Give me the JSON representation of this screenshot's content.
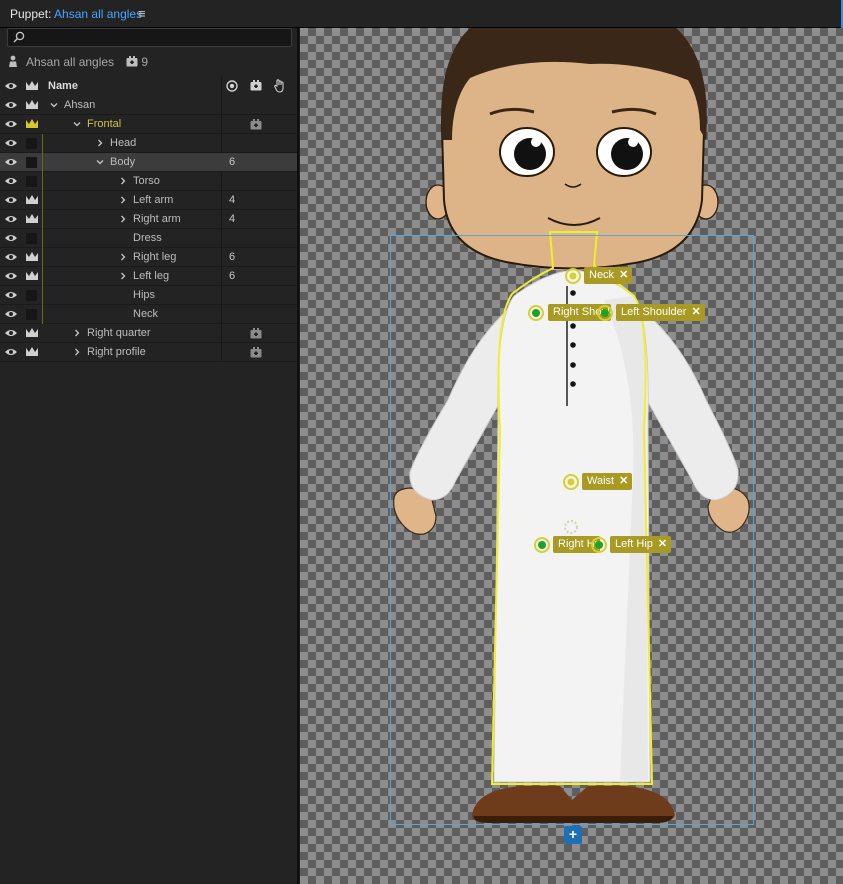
{
  "window": {
    "panel_prefix": "Puppet:",
    "document_name": "Ahsan all angles",
    "menu_icon": "hamburger-menu-icon"
  },
  "search": {
    "placeholder": "",
    "icon": "search-icon"
  },
  "puppet_header": {
    "name": "Ahsan all angles",
    "count": "9"
  },
  "columns": {
    "name": "Name"
  },
  "layers": [
    {
      "label": "Ahsan",
      "expanded": true,
      "indent": 0,
      "crown": true,
      "num": "",
      "camera": false,
      "color": "#bdbdbd"
    },
    {
      "label": "Frontal",
      "expanded": true,
      "indent": 1,
      "crown": true,
      "crown_color": "#d8c727",
      "num": "",
      "camera": true,
      "color": "#cfc14a"
    },
    {
      "label": "Head",
      "expanded": false,
      "indent": 2,
      "crown": false,
      "num": "",
      "camera": false,
      "color": "#bdbdbd"
    },
    {
      "label": "Body",
      "expanded": true,
      "indent": 2,
      "crown": false,
      "num": "6",
      "camera": false,
      "selected": true,
      "color": "#bdbdbd"
    },
    {
      "label": "Torso",
      "expanded": false,
      "indent": 3,
      "crown": false,
      "num": "",
      "camera": false,
      "color": "#bdbdbd"
    },
    {
      "label": "Left arm",
      "expanded": false,
      "indent": 3,
      "crown": true,
      "num": "4",
      "camera": false,
      "color": "#bdbdbd"
    },
    {
      "label": "Right arm",
      "expanded": false,
      "indent": 3,
      "crown": true,
      "num": "4",
      "camera": false,
      "color": "#bdbdbd"
    },
    {
      "label": "Dress",
      "expanded": null,
      "indent": 3,
      "crown": false,
      "num": "",
      "camera": false,
      "color": "#bdbdbd"
    },
    {
      "label": "Right leg",
      "expanded": false,
      "indent": 3,
      "crown": true,
      "num": "6",
      "camera": false,
      "color": "#bdbdbd"
    },
    {
      "label": "Left leg",
      "expanded": false,
      "indent": 3,
      "crown": true,
      "num": "6",
      "camera": false,
      "color": "#bdbdbd"
    },
    {
      "label": "Hips",
      "expanded": null,
      "indent": 3,
      "crown": false,
      "num": "",
      "camera": false,
      "color": "#bdbdbd"
    },
    {
      "label": "Neck",
      "expanded": null,
      "indent": 3,
      "crown": false,
      "num": "",
      "camera": false,
      "color": "#bdbdbd"
    },
    {
      "label": "Right quarter",
      "expanded": false,
      "indent": 1,
      "crown": true,
      "num": "",
      "camera": true,
      "color": "#bdbdbd"
    },
    {
      "label": "Right profile",
      "expanded": false,
      "indent": 1,
      "crown": true,
      "num": "",
      "camera": true,
      "color": "#bdbdbd"
    }
  ],
  "handles": {
    "neck": "Neck",
    "right_shoulder": "Right Shoulder",
    "left_shoulder": "Left Shoulder",
    "waist": "Waist",
    "right_hip": "Right Hip",
    "left_hip": "Left Hip"
  },
  "add_button": "+",
  "colors": {
    "accent": "#4aa3ff",
    "handle_tag": "#a89a22",
    "selection_outline": "#f2ee2a",
    "bounds": "#5aa6d6"
  }
}
